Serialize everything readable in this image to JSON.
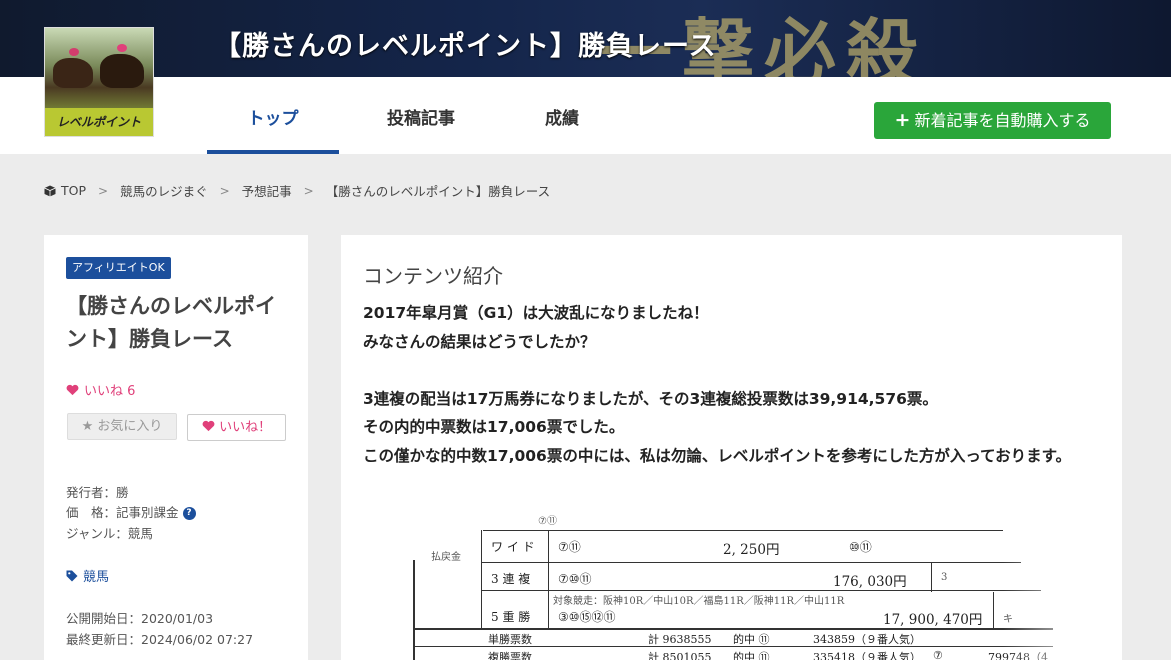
{
  "header": {
    "title": "【勝さんのレベルポイント】勝負レース",
    "decor_text": "一撃必殺"
  },
  "logo": {
    "text": "レベルポイント"
  },
  "nav": {
    "tabs": [
      {
        "label": "トップ",
        "active": true
      },
      {
        "label": "投稿記事",
        "active": false
      },
      {
        "label": "成績",
        "active": false
      }
    ],
    "buy_button": "新着記事を自動購入する"
  },
  "breadcrumb": [
    "TOP",
    "競馬のレジまぐ",
    "予想記事",
    "【勝さんのレベルポイント】勝負レース"
  ],
  "sidebar": {
    "badge": "アフィリエイトOK",
    "title": "【勝さんのレベルポイント】勝負レース",
    "like_count": "いいね 6",
    "fav_button": "お気に入り",
    "like_button": "いいね！",
    "publisher": "発行者：勝",
    "price": "価　格：記事別課金",
    "genre": "ジャンル：競馬",
    "tag": "競馬",
    "published": "公開開始日：2020/01/03",
    "updated": "最終更新日：2024/06/02 07:27"
  },
  "main": {
    "section_title": "コンテンツ紹介",
    "paragraphs": [
      "2017年皐月賞（G1）は大波乱になりましたね！",
      "みなさんの結果はどうでしたか？",
      "",
      "3連複の配当は17万馬券になりましたが、その3連複総投票数は39,914,576票。",
      "その内的中票数は17,006票でした。",
      "この僅かな的中数17,006票の中には、私は勿論、レベルポイントを参考にした方が入っております。"
    ]
  },
  "sheet": {
    "row0_combo": "⑦⑪",
    "label_payout": "払戻金",
    "wide_label": "ワ イ ド",
    "wide_combo": "⑦⑪",
    "wide_amount": "2, 250円",
    "wide_combo2": "⑩⑪",
    "sanrenpuku_label": "3 連 複",
    "sanrenpuku_combo": "⑦⑩⑪",
    "sanrenpuku_amount": "176, 030円",
    "sanrenpuku_extra": "3",
    "target_races": "対象競走：阪神10R／中山10R／福島11R／阪神11R／中山11R",
    "win5_label": "5 重 勝",
    "win5_combo": "③⑩⑮⑫⑪",
    "win5_amount": "17, 900, 470円",
    "win5_extra": "キ",
    "tansho_label": "単勝票数",
    "tansho_total": "計 9638555",
    "tansho_hit": "的中 ⑪",
    "tansho_votes": "343859（９番人気）",
    "fukusho_label": "複勝票数",
    "fukusho_total": "計 8501055",
    "fukusho_hit": "的中 ⑪",
    "fukusho_votes": "335418（９番人気）",
    "fukusho_num": "⑦",
    "fukusho_votes2": "799748（4"
  }
}
